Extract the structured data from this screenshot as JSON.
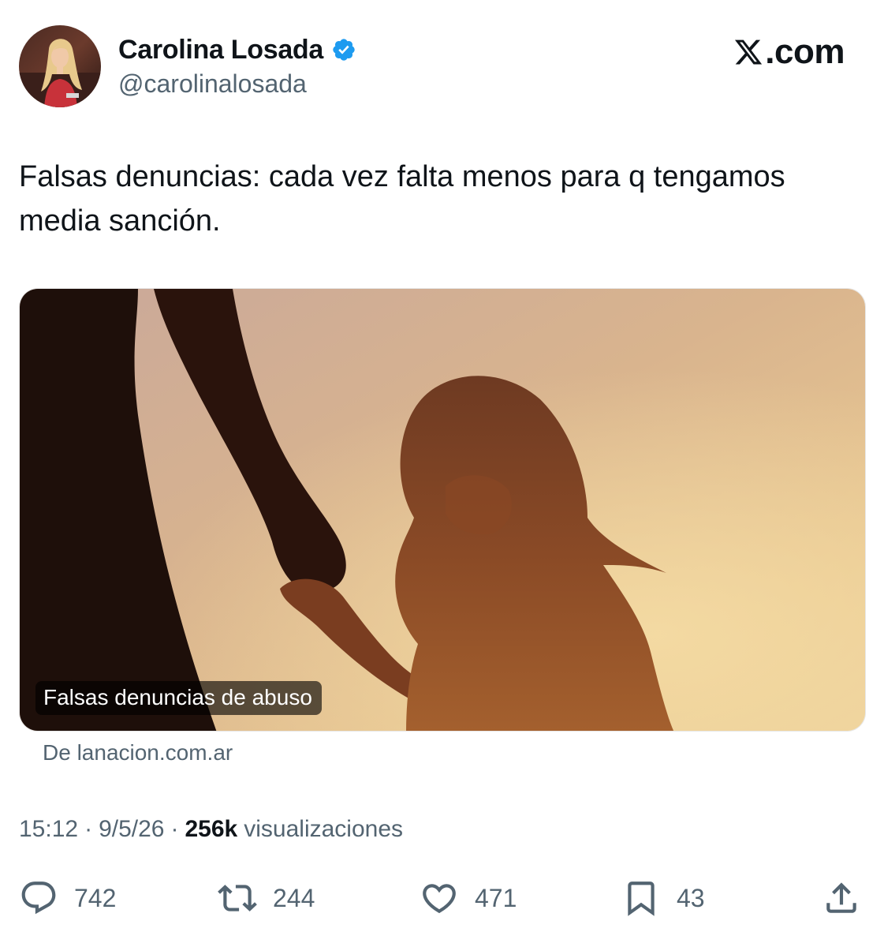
{
  "author": {
    "display_name": "Carolina Losada",
    "handle": "@carolinalosada",
    "verified_icon": "verified-badge-icon"
  },
  "brand": {
    "label": ".com",
    "icon": "x-logo-icon"
  },
  "tweet": {
    "text": "Falsas denuncias: cada vez falta menos para q tengamos media sanción."
  },
  "card": {
    "caption": "Falsas denuncias de abuso",
    "source": "De lanacion.com.ar"
  },
  "meta": {
    "time": "15:12",
    "separator": "·",
    "date": "9/5/26",
    "views_count": "256k",
    "views_label": "visualizaciones"
  },
  "actions": {
    "replies": {
      "icon": "reply-icon",
      "count": "742"
    },
    "reposts": {
      "icon": "repost-icon",
      "count": "244"
    },
    "likes": {
      "icon": "heart-icon",
      "count": "471"
    },
    "bookmarks": {
      "icon": "bookmark-icon",
      "count": "43"
    },
    "share": {
      "icon": "share-icon"
    }
  },
  "colors": {
    "text_primary": "#0f1419",
    "text_secondary": "#536471",
    "verified_blue": "#1d9bf0"
  }
}
